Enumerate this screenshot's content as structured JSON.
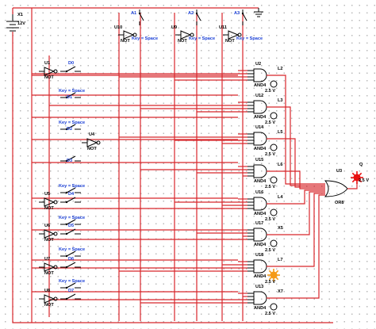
{
  "battery": {
    "name": "X1",
    "voltage": "12V"
  },
  "top_switches": [
    {
      "label": "A1",
      "name": "U10",
      "type": "NOT",
      "key": "Key = Space"
    },
    {
      "label": "A2",
      "name": "U9",
      "type": "NOT",
      "key": "Key = Space"
    },
    {
      "label": "A3",
      "name": "U11",
      "type": "NOT",
      "key": "Key = Space"
    }
  ],
  "left_inverters": [
    {
      "name": "U1",
      "type": "NOT",
      "switch": "D0"
    },
    {
      "name": "U5",
      "type": "NOT",
      "switch": "D4"
    },
    {
      "name": "U6",
      "type": "NOT",
      "switch": "D5"
    },
    {
      "name": "U7",
      "type": "NOT",
      "switch": "D6"
    },
    {
      "name": "U8",
      "type": "NOT",
      "switch": "D7"
    }
  ],
  "switches": [
    {
      "key": "Key = Space",
      "label": "D1"
    },
    {
      "key": "Key = Space",
      "label": "D2"
    },
    {
      "key": "",
      "label": "D3"
    },
    {
      "key": "Key = Space",
      "label": ""
    },
    {
      "key": "Key = Space",
      "label": ""
    },
    {
      "key": "Key = Space",
      "label": ""
    },
    {
      "key": "Key = Space",
      "label": ""
    }
  ],
  "mid_inverter": {
    "name": "U4",
    "type": "NOT"
  },
  "and_gates": [
    {
      "name": "U2",
      "type": "AND4",
      "probe": "L2",
      "voltage": "2.5 V"
    },
    {
      "name": "U12",
      "type": "AND4",
      "probe": "L3",
      "voltage": "2.5 V"
    },
    {
      "name": "U14",
      "type": "AND4",
      "probe": "L5",
      "voltage": "2.5 V"
    },
    {
      "name": "U15",
      "type": "AND4",
      "probe": "L6",
      "voltage": "2.5 V"
    },
    {
      "name": "U16",
      "type": "AND4",
      "probe": "L4",
      "voltage": "2.5 V"
    },
    {
      "name": "U17",
      "type": "AND4",
      "probe": "X5",
      "voltage": "2.5 V"
    },
    {
      "name": "U18",
      "type": "AND4",
      "probe": "L7",
      "voltage": "2.5 V"
    },
    {
      "name": "U13",
      "type": "AND4",
      "probe": "X7",
      "voltage": "2.5 V"
    }
  ],
  "or_gate": {
    "name": "U3",
    "type": "OR8"
  },
  "output_probe": {
    "name": "Q",
    "voltage": "2.5 V"
  },
  "colors": {
    "wire": "#d8262b",
    "label_blue": "#1a3fd6",
    "probe_lit_red": "#e81010",
    "probe_lit_orange": "#f59a16"
  }
}
